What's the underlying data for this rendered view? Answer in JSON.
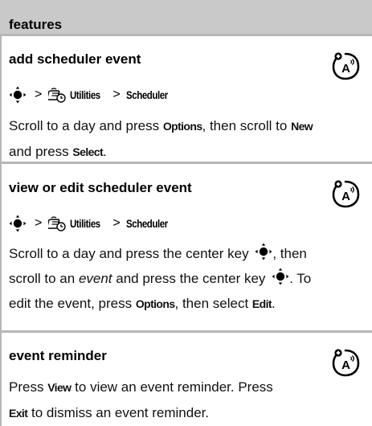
{
  "header": {
    "title": "features"
  },
  "sections": [
    {
      "title": "add scheduler event",
      "path": {
        "app": "Utilities",
        "item": "Scheduler",
        "separator": ">"
      },
      "body": {
        "line1_pre": "Scroll to a day and press ",
        "key_options": "Options",
        "line1_post": ", then scroll to ",
        "key_new": "New",
        "line2_pre": "and press ",
        "key_select": "Select",
        "line2_post": "."
      }
    },
    {
      "title": "view or edit scheduler event",
      "path": {
        "app": "Utilities",
        "item": "Scheduler",
        "separator": ">"
      },
      "body": {
        "l1_pre": "Scroll to a day and press the center key ",
        "l1_post": ", then",
        "l2_pre": "scroll to an ",
        "l2_em": "event",
        "l2_mid": " and press the center key ",
        "l2_post": ". To",
        "l3_pre": "edit the event, press ",
        "key_options": "Options",
        "l3_mid": ", then select ",
        "key_edit": "Edit",
        "l3_post": "."
      }
    },
    {
      "title": "event reminder",
      "body": {
        "l1_pre": "Press ",
        "key_view": "View",
        "l1_post": " to view an event reminder. Press",
        "key_exit": "Exit",
        "l2_post": " to dismiss an event reminder."
      }
    }
  ],
  "icons": {
    "network_feature": "network-dependent-feature-icon",
    "nav_key": "navigation-key-icon",
    "utilities_app": "utilities-app-icon"
  },
  "colors": {
    "header_bg": "#c9c9c9",
    "rule": "#b7b7b7",
    "text": "#111111"
  }
}
